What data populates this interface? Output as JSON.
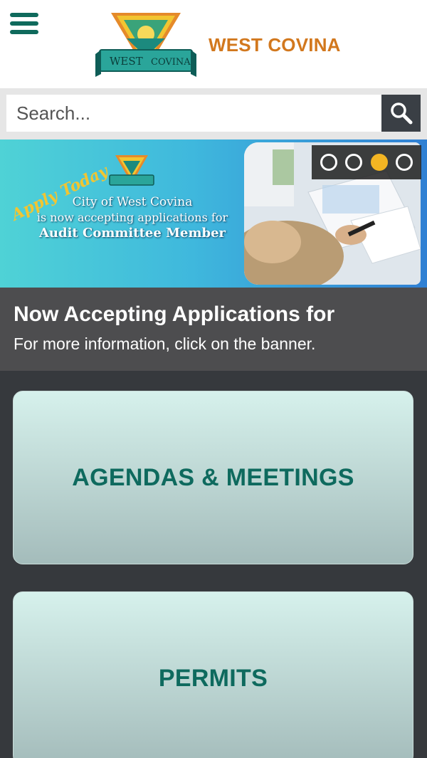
{
  "header": {
    "brand_name": "WEST COVINA",
    "logo_text_left": "WEST",
    "logo_text_right": "COVINA"
  },
  "search": {
    "placeholder": "Search..."
  },
  "banner": {
    "apply_text": "Apply Today",
    "line1": "City of West Covina",
    "line2": "is now accepting applications for",
    "line3": "Audit Committee Member",
    "slides": [
      {
        "active": false
      },
      {
        "active": false
      },
      {
        "active": true
      },
      {
        "active": false
      }
    ]
  },
  "caption": {
    "title": "Now Accepting Applications for",
    "subtitle": "For more information, click on the banner."
  },
  "tiles": [
    {
      "label": "AGENDAS & MEETINGS"
    },
    {
      "label": "PERMITS"
    }
  ],
  "colors": {
    "brand_green": "#0f6a5c",
    "brand_orange": "#d2781e",
    "active_dot": "#f3b523",
    "page_dark": "#36393d"
  },
  "icons": {
    "menu": "hamburger-icon",
    "search": "magnifier-icon"
  }
}
